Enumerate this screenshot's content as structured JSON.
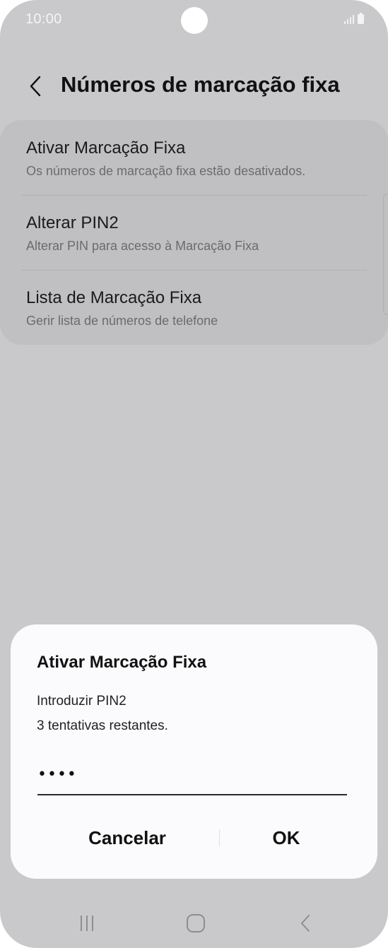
{
  "status_bar": {
    "time": "10:00",
    "icons": [
      "signal-icon",
      "battery-icon"
    ]
  },
  "header": {
    "back_icon": "chevron-left-icon",
    "title": "Números de marcação fixa"
  },
  "settings": {
    "items": [
      {
        "title": "Ativar Marcação Fixa",
        "subtitle": "Os números de marcação fixa estão desativados."
      },
      {
        "title": "Alterar PIN2",
        "subtitle": "Alterar PIN para acesso à Marcação Fixa"
      },
      {
        "title": "Lista de Marcação Fixa",
        "subtitle": "Gerir lista de números de telefone"
      }
    ]
  },
  "dialog": {
    "title": "Ativar Marcação Fixa",
    "prompt": "Introduzir PIN2",
    "attempts": "3 tentativas restantes.",
    "pin_value": "••••",
    "cancel_label": "Cancelar",
    "ok_label": "OK"
  },
  "nav_bar": {
    "icons": [
      "recents-icon",
      "home-icon",
      "back-icon"
    ]
  },
  "colors": {
    "background": "#c9c9cb",
    "card": "#c0c0c2",
    "dialog": "#fbfbfd",
    "text": "#111111",
    "secondary_text": "#6b6b6d"
  }
}
